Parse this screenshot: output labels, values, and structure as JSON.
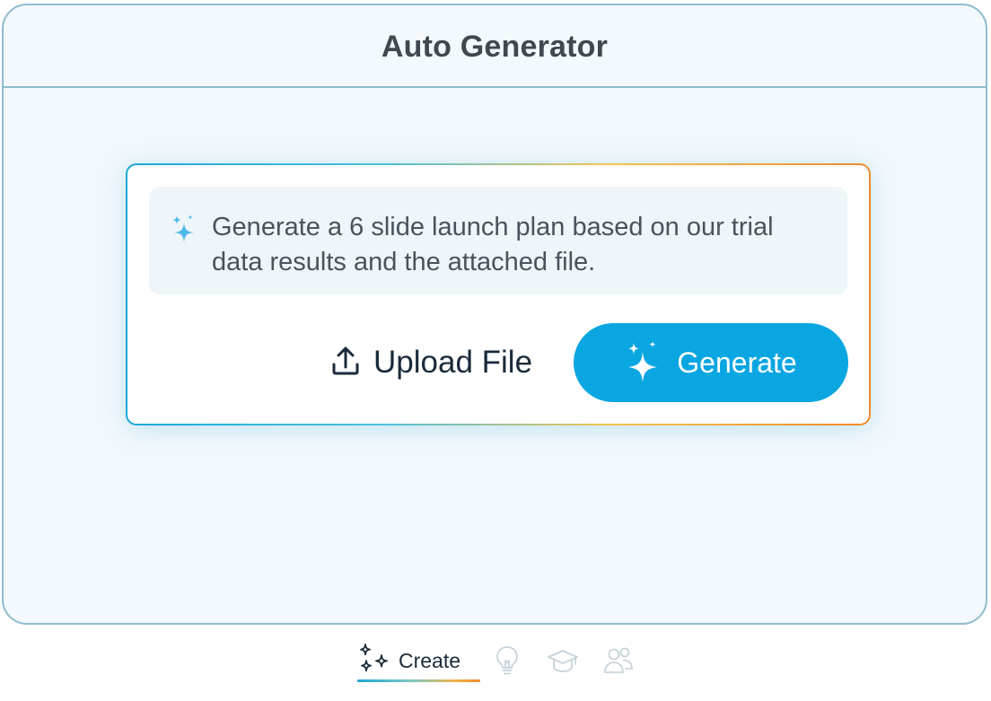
{
  "window": {
    "title": "Auto Generator"
  },
  "prompt": {
    "icon": "sparkles-icon",
    "text": "Generate a 6 slide launch plan based on our trial data results and the attached file."
  },
  "actions": {
    "upload_label": "Upload File",
    "upload_icon": "upload-icon",
    "generate_label": "Generate",
    "generate_icon": "sparkles-icon"
  },
  "bottom_nav": {
    "items": [
      {
        "label": "Create",
        "icon": "sparkles-icon",
        "active": true
      },
      {
        "label": "",
        "icon": "lightbulb-icon",
        "active": false
      },
      {
        "label": "",
        "icon": "graduation-cap-icon",
        "active": false
      },
      {
        "label": "",
        "icon": "users-icon",
        "active": false
      }
    ]
  },
  "colors": {
    "accent": "#0aa6e2",
    "frame_border": "#8fbccf",
    "frame_background": "#f3f9fc",
    "gradient_start": "#1aa8d8",
    "gradient_end": "#ef8a2e"
  }
}
